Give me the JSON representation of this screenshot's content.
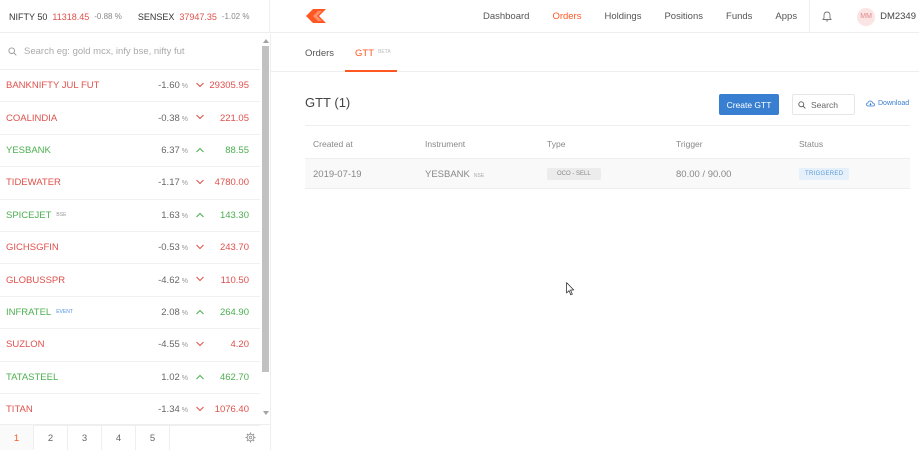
{
  "topbar": {
    "indices": [
      {
        "name": "NIFTY 50",
        "value": "11318.45",
        "change": "-0.88 %"
      },
      {
        "name": "SENSEX",
        "value": "37947.35",
        "change": "-1.02 %"
      }
    ],
    "nav": [
      "Dashboard",
      "Orders",
      "Holdings",
      "Positions",
      "Funds",
      "Apps"
    ],
    "active_nav": "Orders",
    "avatar_initials": "MM",
    "user_id": "DM2349"
  },
  "sidebar": {
    "search_placeholder": "Search eg: gold mcx, infy bse, nifty fut",
    "watchlist": [
      {
        "symbol": "BANKNIFTY JUL FUT",
        "tag": "",
        "change": "-1.60",
        "price": "29305.95",
        "dir": "down"
      },
      {
        "symbol": "COALINDIA",
        "tag": "",
        "change": "-0.38",
        "price": "221.05",
        "dir": "down"
      },
      {
        "symbol": "YESBANK",
        "tag": "",
        "change": "6.37",
        "price": "88.55",
        "dir": "up"
      },
      {
        "symbol": "TIDEWATER",
        "tag": "",
        "change": "-1.17",
        "price": "4780.00",
        "dir": "down"
      },
      {
        "symbol": "SPICEJET",
        "tag": "BSE",
        "change": "1.63",
        "price": "143.30",
        "dir": "up"
      },
      {
        "symbol": "GICHSGFIN",
        "tag": "",
        "change": "-0.53",
        "price": "243.70",
        "dir": "down"
      },
      {
        "symbol": "GLOBUSSPR",
        "tag": "",
        "change": "-4.62",
        "price": "110.50",
        "dir": "down"
      },
      {
        "symbol": "INFRATEL",
        "tag": "EVENT",
        "change": "2.08",
        "price": "264.90",
        "dir": "up"
      },
      {
        "symbol": "SUZLON",
        "tag": "",
        "change": "-4.55",
        "price": "4.20",
        "dir": "down"
      },
      {
        "symbol": "TATASTEEL",
        "tag": "",
        "change": "1.02",
        "price": "462.70",
        "dir": "up"
      },
      {
        "symbol": "TITAN",
        "tag": "",
        "change": "-1.34",
        "price": "1076.40",
        "dir": "down"
      }
    ],
    "percent_unit": "%",
    "pages": [
      "1",
      "2",
      "3",
      "4",
      "5"
    ],
    "active_page": "1"
  },
  "main": {
    "tabs": [
      {
        "label": "Orders",
        "badge": ""
      },
      {
        "label": "GTT",
        "badge": "BETA"
      }
    ],
    "title": "GTT (1)",
    "create_label": "Create GTT",
    "search_placeholder": "Search",
    "download_label": "Download",
    "columns": [
      "Created at",
      "Instrument",
      "Type",
      "Trigger",
      "Status"
    ],
    "rows": [
      {
        "created_at": "2019-07-19",
        "instrument": "YESBANK",
        "exchange": "NSE",
        "type": "OCO - SELL",
        "trigger": "80.00 / 90.00",
        "status": "TRIGGERED"
      }
    ]
  },
  "colors": {
    "accent": "#ff5722",
    "negative": "#df514c",
    "positive": "#4caf50",
    "button": "#387ed1"
  }
}
